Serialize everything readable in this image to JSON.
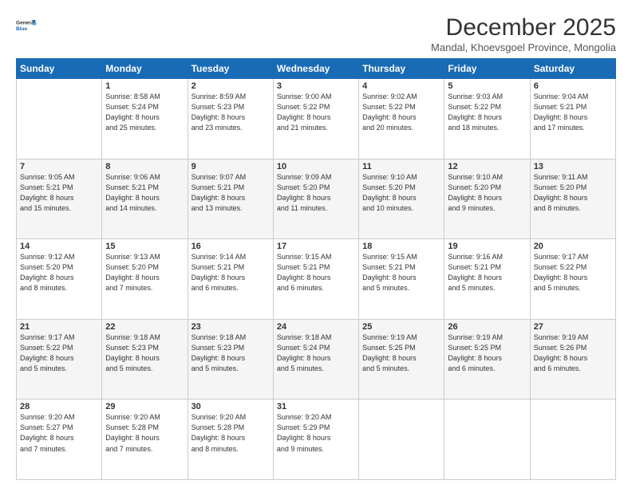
{
  "logo": {
    "line1": "General",
    "line2": "Blue"
  },
  "header": {
    "month": "December 2025",
    "location": "Mandal, Khoevsgoel Province, Mongolia"
  },
  "weekdays": [
    "Sunday",
    "Monday",
    "Tuesday",
    "Wednesday",
    "Thursday",
    "Friday",
    "Saturday"
  ],
  "weeks": [
    [
      {
        "day": "",
        "info": ""
      },
      {
        "day": "1",
        "info": "Sunrise: 8:58 AM\nSunset: 5:24 PM\nDaylight: 8 hours\nand 25 minutes."
      },
      {
        "day": "2",
        "info": "Sunrise: 8:59 AM\nSunset: 5:23 PM\nDaylight: 8 hours\nand 23 minutes."
      },
      {
        "day": "3",
        "info": "Sunrise: 9:00 AM\nSunset: 5:22 PM\nDaylight: 8 hours\nand 21 minutes."
      },
      {
        "day": "4",
        "info": "Sunrise: 9:02 AM\nSunset: 5:22 PM\nDaylight: 8 hours\nand 20 minutes."
      },
      {
        "day": "5",
        "info": "Sunrise: 9:03 AM\nSunset: 5:22 PM\nDaylight: 8 hours\nand 18 minutes."
      },
      {
        "day": "6",
        "info": "Sunrise: 9:04 AM\nSunset: 5:21 PM\nDaylight: 8 hours\nand 17 minutes."
      }
    ],
    [
      {
        "day": "7",
        "info": "Sunrise: 9:05 AM\nSunset: 5:21 PM\nDaylight: 8 hours\nand 15 minutes."
      },
      {
        "day": "8",
        "info": "Sunrise: 9:06 AM\nSunset: 5:21 PM\nDaylight: 8 hours\nand 14 minutes."
      },
      {
        "day": "9",
        "info": "Sunrise: 9:07 AM\nSunset: 5:21 PM\nDaylight: 8 hours\nand 13 minutes."
      },
      {
        "day": "10",
        "info": "Sunrise: 9:09 AM\nSunset: 5:20 PM\nDaylight: 8 hours\nand 11 minutes."
      },
      {
        "day": "11",
        "info": "Sunrise: 9:10 AM\nSunset: 5:20 PM\nDaylight: 8 hours\nand 10 minutes."
      },
      {
        "day": "12",
        "info": "Sunrise: 9:10 AM\nSunset: 5:20 PM\nDaylight: 8 hours\nand 9 minutes."
      },
      {
        "day": "13",
        "info": "Sunrise: 9:11 AM\nSunset: 5:20 PM\nDaylight: 8 hours\nand 8 minutes."
      }
    ],
    [
      {
        "day": "14",
        "info": "Sunrise: 9:12 AM\nSunset: 5:20 PM\nDaylight: 8 hours\nand 8 minutes."
      },
      {
        "day": "15",
        "info": "Sunrise: 9:13 AM\nSunset: 5:20 PM\nDaylight: 8 hours\nand 7 minutes."
      },
      {
        "day": "16",
        "info": "Sunrise: 9:14 AM\nSunset: 5:21 PM\nDaylight: 8 hours\nand 6 minutes."
      },
      {
        "day": "17",
        "info": "Sunrise: 9:15 AM\nSunset: 5:21 PM\nDaylight: 8 hours\nand 6 minutes."
      },
      {
        "day": "18",
        "info": "Sunrise: 9:15 AM\nSunset: 5:21 PM\nDaylight: 8 hours\nand 5 minutes."
      },
      {
        "day": "19",
        "info": "Sunrise: 9:16 AM\nSunset: 5:21 PM\nDaylight: 8 hours\nand 5 minutes."
      },
      {
        "day": "20",
        "info": "Sunrise: 9:17 AM\nSunset: 5:22 PM\nDaylight: 8 hours\nand 5 minutes."
      }
    ],
    [
      {
        "day": "21",
        "info": "Sunrise: 9:17 AM\nSunset: 5:22 PM\nDaylight: 8 hours\nand 5 minutes."
      },
      {
        "day": "22",
        "info": "Sunrise: 9:18 AM\nSunset: 5:23 PM\nDaylight: 8 hours\nand 5 minutes."
      },
      {
        "day": "23",
        "info": "Sunrise: 9:18 AM\nSunset: 5:23 PM\nDaylight: 8 hours\nand 5 minutes."
      },
      {
        "day": "24",
        "info": "Sunrise: 9:18 AM\nSunset: 5:24 PM\nDaylight: 8 hours\nand 5 minutes."
      },
      {
        "day": "25",
        "info": "Sunrise: 9:19 AM\nSunset: 5:25 PM\nDaylight: 8 hours\nand 5 minutes."
      },
      {
        "day": "26",
        "info": "Sunrise: 9:19 AM\nSunset: 5:25 PM\nDaylight: 8 hours\nand 6 minutes."
      },
      {
        "day": "27",
        "info": "Sunrise: 9:19 AM\nSunset: 5:26 PM\nDaylight: 8 hours\nand 6 minutes."
      }
    ],
    [
      {
        "day": "28",
        "info": "Sunrise: 9:20 AM\nSunset: 5:27 PM\nDaylight: 8 hours\nand 7 minutes."
      },
      {
        "day": "29",
        "info": "Sunrise: 9:20 AM\nSunset: 5:28 PM\nDaylight: 8 hours\nand 7 minutes."
      },
      {
        "day": "30",
        "info": "Sunrise: 9:20 AM\nSunset: 5:28 PM\nDaylight: 8 hours\nand 8 minutes."
      },
      {
        "day": "31",
        "info": "Sunrise: 9:20 AM\nSunset: 5:29 PM\nDaylight: 8 hours\nand 9 minutes."
      },
      {
        "day": "",
        "info": ""
      },
      {
        "day": "",
        "info": ""
      },
      {
        "day": "",
        "info": ""
      }
    ]
  ]
}
